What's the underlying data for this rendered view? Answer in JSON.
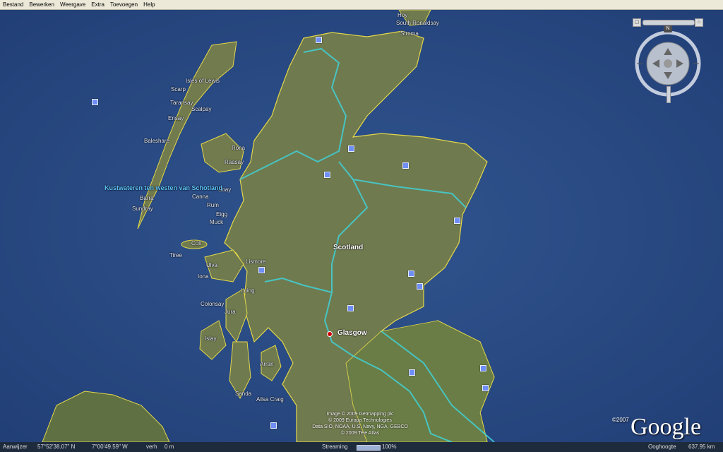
{
  "menu": [
    "Bestand",
    "Bewerken",
    "Weergave",
    "Extra",
    "Toevoegen",
    "Help"
  ],
  "map": {
    "region_label": "Scotland",
    "city_label": "Glasgow",
    "water_label": "Kustwateren ten westen van Schotland",
    "places": [
      "Hoy",
      "South Ronaldsay",
      "Stroma",
      "Isles of Lewis",
      "Scarp",
      "Taransay",
      "Scalpay",
      "Ensay",
      "Baleshare",
      "Rona",
      "Raasay",
      "Soay",
      "Barra",
      "Sundray",
      "Canna",
      "Rum",
      "Eigg",
      "Muck",
      "Coll",
      "Tiree",
      "Ulva",
      "Iona",
      "Lismore",
      "Luing",
      "Colonsay",
      "Jura",
      "Islay",
      "Arran",
      "Sanda",
      "Ailsa Craig"
    ]
  },
  "credits": [
    "Image © 2009 Getmapping plc",
    "© 2009 Europa Technologies",
    "Data SIO, NOAA, U.S. Navy, NGA, GEBCO",
    "© 2009 Tele Atlas"
  ],
  "logo": {
    "text": "Google",
    "year": "©2007"
  },
  "nav": {
    "north": "N"
  },
  "status": {
    "pointer_label": "Aanwijzer",
    "lat": "57°52'38.07\" N",
    "lon": "7°00'49.59\" W",
    "elev_label": "verh",
    "elev": "0 m",
    "streaming_label": "Streaming",
    "streaming_pct": "100%",
    "eye_label": "Ooghoogte",
    "eye": "637.95 km"
  },
  "colors": {
    "ocean": "#2b4a86",
    "land": "#6f7a4e",
    "coast": "#e3d84a",
    "route": "#3fd1d6"
  }
}
